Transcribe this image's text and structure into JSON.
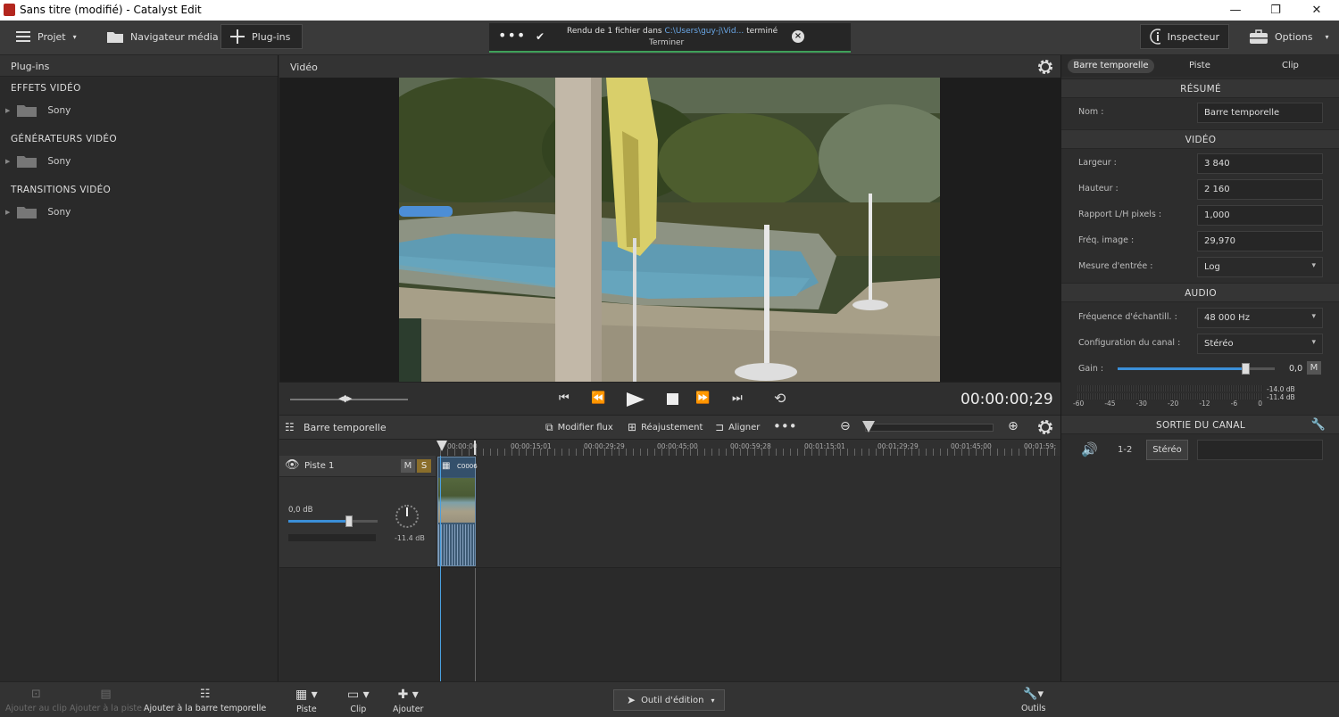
{
  "window": {
    "title": "Sans titre (modifié) - Catalyst Edit",
    "controls": [
      "—",
      "❐",
      "✕"
    ]
  },
  "toolbar": {
    "projet": "Projet",
    "navigateur": "Navigateur média",
    "plugins": "Plug-ins",
    "inspecteur": "Inspecteur",
    "options": "Options"
  },
  "render": {
    "message_prefix": "Rendu de 1 fichier dans",
    "path": "C:\\Users\\guy-j\\Vid...",
    "message_suffix": "terminé",
    "sub": "Terminer",
    "progress": 1.0,
    "accent": "#3fa15a"
  },
  "plugins_panel": {
    "title": "Plug-ins",
    "sections": [
      {
        "title": "EFFETS VIDÉO",
        "folder": "Sony"
      },
      {
        "title": "GÉNÉRATEURS VIDÉO",
        "folder": "Sony"
      },
      {
        "title": "TRANSITIONS VIDÉO",
        "folder": "Sony"
      }
    ]
  },
  "video": {
    "title": "Vidéo",
    "timecode": "00:00:00;29"
  },
  "timeline": {
    "title": "Barre temporelle",
    "modifier_flux": "Modifier flux",
    "reajustement": "Réajustement",
    "aligner": "Aligner",
    "ruler": [
      "00:00:00",
      "00:00:15;01",
      "00:00:29;29",
      "00:00:45;00",
      "00:00:59;28",
      "00:01:15;01",
      "00:01:29;29",
      "00:01:45;00",
      "00:01:59;"
    ],
    "track": {
      "name": "Piste 1",
      "mute": "M",
      "solo": "S",
      "volume_db": "0,0 dB",
      "volume_level": 0.68,
      "pan_value": "-11.4 dB",
      "clip_name": "C0006"
    }
  },
  "bottombar": {
    "ajouter_clip": "Ajouter au clip",
    "ajouter_piste": "Ajouter à la piste",
    "ajouter_barre": "Ajouter à la barre temporelle",
    "piste": "Piste",
    "clip": "Clip",
    "ajouter": "Ajouter",
    "outil": "Outil d'édition",
    "outils": "Outils"
  },
  "inspector": {
    "tabs": [
      "Barre temporelle",
      "Piste",
      "Clip"
    ],
    "resume": {
      "title": "RÉSUMÉ",
      "nom_label": "Nom :",
      "nom_value": "Barre temporelle"
    },
    "video": {
      "title": "VIDÉO",
      "largeur_label": "Largeur :",
      "largeur": "3 840",
      "hauteur_label": "Hauteur :",
      "hauteur": "2 160",
      "rapport_label": "Rapport L/H pixels :",
      "rapport": "1,000",
      "freq_label": "Fréq. image :",
      "freq": "29,970",
      "mesure_label": "Mesure d'entrée :",
      "mesure": "Log"
    },
    "audio": {
      "title": "AUDIO",
      "freq_label": "Fréquence d'échantill. :",
      "freq": "48 000 Hz",
      "config_label": "Configuration du canal :",
      "config": "Stéréo",
      "gain_label": "Gain :",
      "gain": "0,0",
      "gain_level": 0.81,
      "mute": "M",
      "meter_top": "-14.0 dB",
      "meter_bottom": "-11.4 dB",
      "scale": [
        "-60",
        "-45",
        "-30",
        "-20",
        "-12",
        "-6",
        "0"
      ]
    },
    "sortie": {
      "title": "SORTIE DU CANAL",
      "channel": "1-2",
      "mode": "Stéréo"
    }
  }
}
